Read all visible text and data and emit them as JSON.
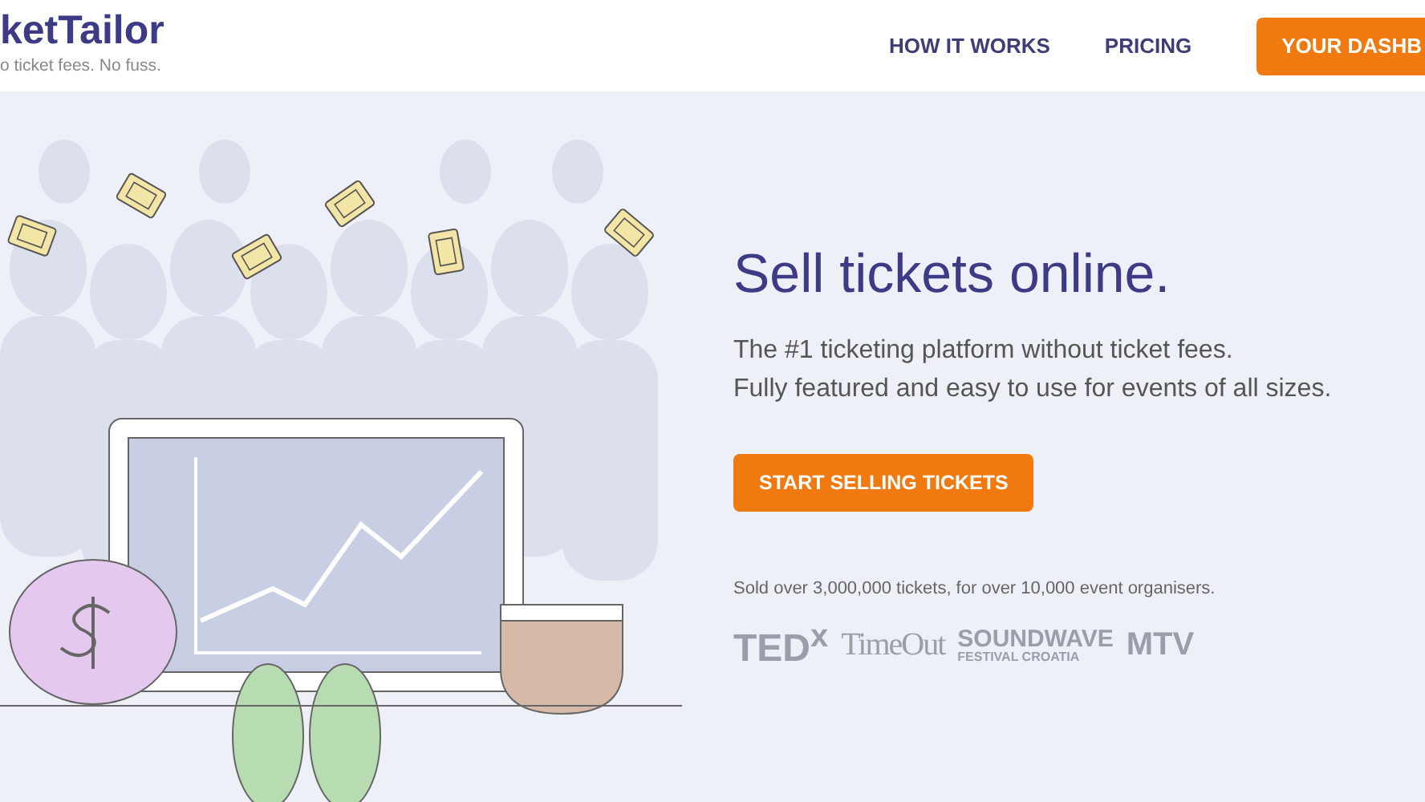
{
  "header": {
    "logo": "ketTailor",
    "tagline": "o ticket fees. No fuss.",
    "nav": [
      "HOW IT WORKS",
      "PRICING"
    ],
    "cta": "YOUR DASHB"
  },
  "hero": {
    "title": "Sell tickets online.",
    "subtitle": [
      "The #1 ticketing platform without ticket fees.",
      "Fully featured and easy to use for events of all sizes."
    ],
    "button": "START SELLING TICKETS",
    "stats": "Sold over 3,000,000 tickets, for over 10,000 event organisers.",
    "logos": [
      {
        "kind": "ted",
        "text": "TED$^{x}$"
      },
      {
        "kind": "timeout",
        "text": "TimeOut"
      },
      {
        "kind": "soundwave",
        "text": "SOUNDWAVE",
        "sub": "FESTIVAL CROATIA"
      },
      {
        "kind": "mtv",
        "text": "MTV"
      }
    ]
  }
}
